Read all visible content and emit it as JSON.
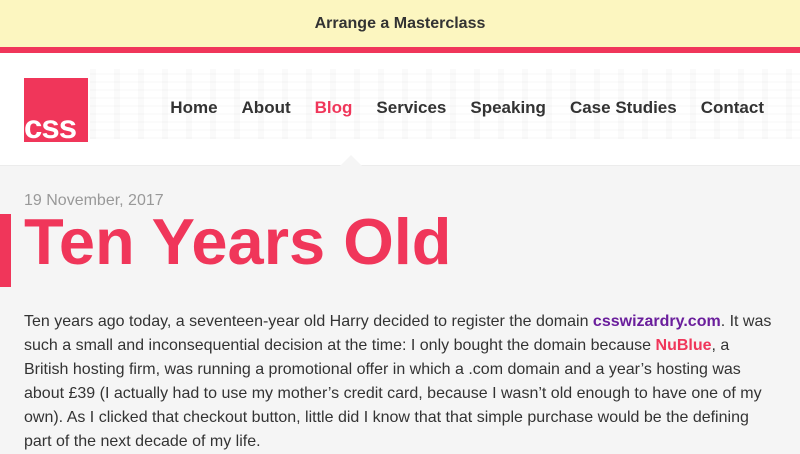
{
  "promo": {
    "text": "Arrange a Masterclass"
  },
  "logo": {
    "text": "css"
  },
  "nav": {
    "items": [
      {
        "label": "Home"
      },
      {
        "label": "About"
      },
      {
        "label": "Blog"
      },
      {
        "label": "Services"
      },
      {
        "label": "Speaking"
      },
      {
        "label": "Case Studies"
      },
      {
        "label": "Contact"
      }
    ],
    "active": "Blog"
  },
  "post": {
    "date": "19 November, 2017",
    "title": "Ten Years Old",
    "body_parts": [
      "Ten years ago today, a seventeen-year old Harry decided to register the domain ",
      "csswizardry.com",
      ". It was such a small and inconsequential decision at the time: I only bought the domain because ",
      "NuBlue",
      ", a British hosting firm, was running a promotional offer in which a .com domain and a year’s hosting was about £39 (I actually had to use my mother’s credit card, because I wasn’t old enough to have one of my own). As I clicked that checkout button, little did I know that that simple purchase would be the defining part of the next decade of my life."
    ]
  },
  "colors": {
    "accent": "#f0365a",
    "promo_background": "#fcf6c0",
    "link_purple": "#6a1e9c",
    "page_background": "#f5f5f5"
  }
}
